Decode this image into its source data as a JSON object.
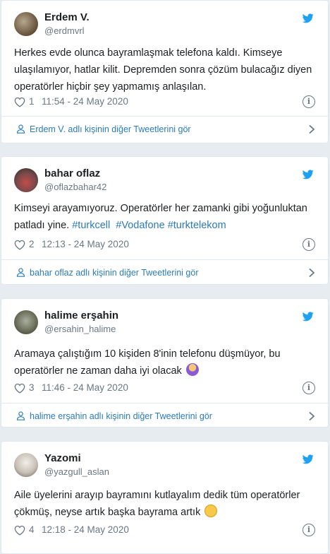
{
  "tweets": [
    {
      "name": "Erdem V.",
      "handle": "@erdmvrl",
      "text": "Herkes evde olunca bayramlaşmak telefona kaldı. Kimseye ulaşılamıyor, hatlar kilit. Depremden sonra çözüm bulacağız diyen operatörler hiçbir şey yapmamış anlaşılan.",
      "likes": "1",
      "time": "11:54 - 24 May 2020",
      "more": "Erdem V. adlı kişinin diğer Tweetlerini gör"
    },
    {
      "name": "bahar oflaz",
      "handle": "@oflazbahar42",
      "text_main": "Kimseyi arayamıyoruz. Operatörler her zamanki gibi yoğunluktan patladı yine. ",
      "hashtags": [
        "#turkcell",
        "#Vodafone",
        "#turktelekom"
      ],
      "likes": "2",
      "time": "12:13 - 24 May 2020",
      "more": "bahar oflaz adlı kişinin diğer Tweetlerini gör"
    },
    {
      "name": "halime erşahin",
      "handle": "@ersahin_halime",
      "text": "Aramaya çalıştığım 10 kişiden 8'inin telefonu düşmüyor, bu operatörler ne zaman daha iyi olacak ",
      "emoji": "woman-facepalming-icon",
      "likes": "3",
      "time": "11:46 - 24 May 2020",
      "more": "halime erşahin adlı kişinin diğer Tweetlerini gör"
    },
    {
      "name": "Yazomi",
      "handle": "@yazgull_aslan",
      "text": "Aile üyelerini arayıp bayramını kutlayalım dedik tüm operatörler çökmüş, neyse artık başka bayrama artık ",
      "emoji": "grinning-face-icon",
      "likes": "4",
      "time": "12:18 - 24 May 2020"
    }
  ],
  "colors": {
    "background": "#e6ecf0",
    "link": "#2b7bb9",
    "twitter_blue": "#1da1f2",
    "muted": "#697882"
  }
}
